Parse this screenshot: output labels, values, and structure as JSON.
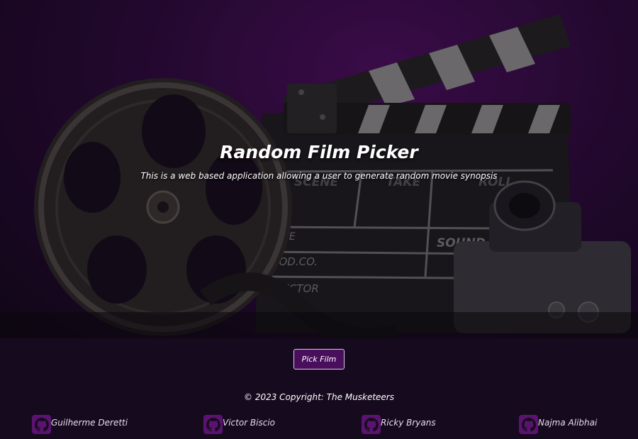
{
  "hero": {
    "title": "Random Film Picker",
    "subtitle": "This is a web based application allowing a user to generate random movie synopsis",
    "clapper_labels": {
      "scene": "SCENE",
      "take": "TAKE",
      "roll": "ROLL",
      "date": "DATE",
      "sound": "SOUND",
      "prod": "PROD.CO.",
      "director": "DIRECTOR"
    }
  },
  "actions": {
    "pick_label": "Pick Film"
  },
  "footer": {
    "copyright": "© 2023 Copyright: The Musketeers",
    "members": [
      {
        "name": "Guilherme Deretti",
        "icon": "github-icon"
      },
      {
        "name": "Victor Biscio",
        "icon": "github-icon"
      },
      {
        "name": "Ricky Bryans",
        "icon": "github-icon"
      },
      {
        "name": "Najma Alibhai",
        "icon": "github-icon"
      }
    ]
  },
  "colors": {
    "accent": "#4a0f5c",
    "background": "#160a1e",
    "icon_bg": "#5a1470"
  }
}
